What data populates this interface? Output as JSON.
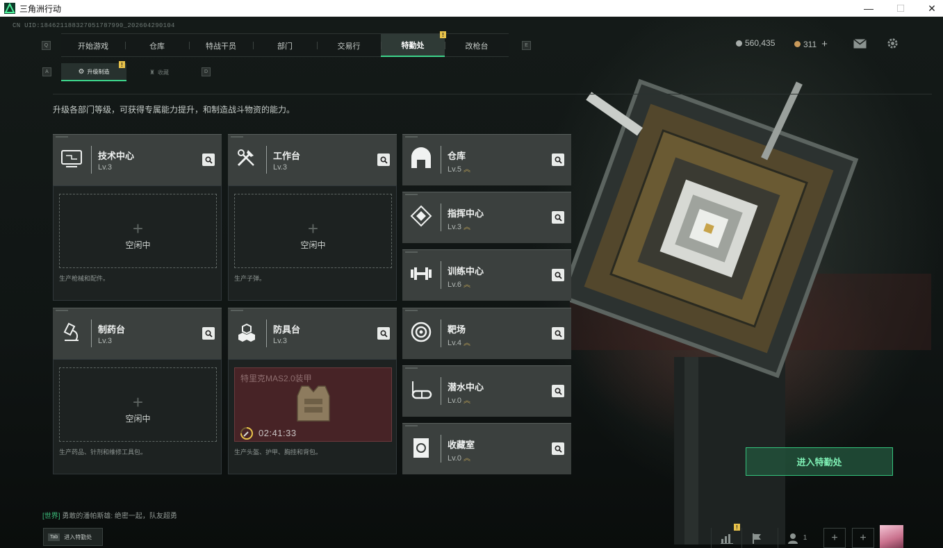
{
  "window": {
    "title": "三角洲行动"
  },
  "uid": "CN UID:184621188327051787990_202604290104",
  "nav": {
    "left_key": "Q",
    "right_key": "E",
    "tabs": [
      {
        "label": "开始游戏"
      },
      {
        "label": "仓库"
      },
      {
        "label": "特战干员"
      },
      {
        "label": "部门"
      },
      {
        "label": "交易行"
      },
      {
        "label": "特勤处",
        "active": true,
        "badge": "!"
      },
      {
        "label": "改枪台"
      }
    ]
  },
  "subnav": {
    "left_key": "A",
    "right_key": "D",
    "tabs": [
      {
        "label": "升级制造",
        "active": true,
        "badge": "!"
      },
      {
        "label": "收藏"
      }
    ]
  },
  "currency": {
    "silver": "560,435",
    "gold": "311",
    "add": "+"
  },
  "description": "升级各部门等级，可获得专属能力提升，和制造战斗物资的能力。",
  "production": [
    {
      "name": "技术中心",
      "level": "Lv.3",
      "icon": "computer-icon",
      "slot": {
        "status": "空闲中"
      },
      "note": "生产枪械和配件。"
    },
    {
      "name": "工作台",
      "level": "Lv.3",
      "icon": "tools-icon",
      "slot": {
        "status": "空闲中"
      },
      "note": "生产子弹。"
    },
    {
      "name": "制药台",
      "level": "Lv.3",
      "icon": "microscope-icon",
      "slot": {
        "status": "空闲中"
      },
      "note": "生产药品、针剂和维修工具包。"
    },
    {
      "name": "防具台",
      "level": "Lv.3",
      "icon": "cubes-icon",
      "slot": {
        "item": "特里克MAS2.0装甲",
        "timer": "02:41:33"
      },
      "note": "生产头盔、护甲、胸挂和背包。"
    }
  ],
  "departments": [
    {
      "name": "仓库",
      "level": "Lv.5",
      "icon": "warehouse-icon"
    },
    {
      "name": "指挥中心",
      "level": "Lv.3",
      "icon": "command-icon"
    },
    {
      "name": "训练中心",
      "level": "Lv.6",
      "icon": "dumbbell-icon"
    },
    {
      "name": "靶场",
      "level": "Lv.4",
      "icon": "target-icon"
    },
    {
      "name": "潜水中心",
      "level": "Lv.0",
      "icon": "diving-mask-icon"
    },
    {
      "name": "收藏室",
      "level": "Lv.0",
      "icon": "collection-icon"
    }
  ],
  "enter_button": "进入特勤处",
  "chat": {
    "channel": "[世界]",
    "message": "勇敢的潘帕斯雄: 绝密一起，队友超勇"
  },
  "tab_hint": {
    "key": "Tab",
    "label": "进入特勤处"
  },
  "bottom_bar": {
    "badge": "!",
    "friends_count": "1"
  },
  "colors": {
    "accent": "#3dd68c",
    "badge": "#e8c24a",
    "production_active": "#472326"
  }
}
